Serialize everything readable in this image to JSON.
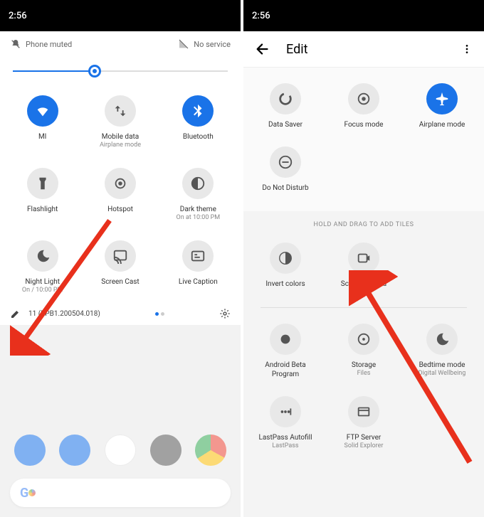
{
  "left": {
    "time": "2:56",
    "muted": "Phone muted",
    "service": "No service",
    "brightness_pct": 38,
    "tiles": [
      {
        "label": "MI",
        "sub": "",
        "on": true,
        "icon": "wifi"
      },
      {
        "label": "Mobile data",
        "sub": "Airplane mode",
        "on": false,
        "icon": "swap"
      },
      {
        "label": "Bluetooth",
        "sub": "",
        "on": true,
        "icon": "bluetooth"
      },
      {
        "label": "Flashlight",
        "sub": "",
        "on": false,
        "icon": "flashlight"
      },
      {
        "label": "Hotspot",
        "sub": "",
        "on": false,
        "icon": "hotspot"
      },
      {
        "label": "Dark theme",
        "sub": "On at 10:00 PM",
        "on": false,
        "icon": "dark"
      },
      {
        "label": "Night Light",
        "sub": "On / 10:00 PM",
        "on": false,
        "icon": "moon"
      },
      {
        "label": "Screen Cast",
        "sub": "",
        "on": false,
        "icon": "cast"
      },
      {
        "label": "Live Caption",
        "sub": "",
        "on": false,
        "icon": "caption"
      }
    ],
    "build": "11 (RPB1.200504.018)"
  },
  "right": {
    "time": "2:56",
    "title": "Edit",
    "active_tiles": [
      {
        "label": "Data Saver",
        "sub": "",
        "on": false,
        "icon": "datasaver"
      },
      {
        "label": "Focus mode",
        "sub": "",
        "on": false,
        "icon": "focus"
      },
      {
        "label": "Airplane mode",
        "sub": "",
        "on": true,
        "icon": "airplane"
      },
      {
        "label": "Do Not Disturb",
        "sub": "",
        "on": false,
        "icon": "dnd"
      }
    ],
    "drag_label": "HOLD AND DRAG TO ADD TILES",
    "inactive_tiles": [
      {
        "label": "Invert colors",
        "sub": "",
        "icon": "invert"
      },
      {
        "label": "Screen Record",
        "sub": "",
        "icon": "record"
      },
      {
        "label": "",
        "sub": "",
        "icon": ""
      },
      {
        "label": "Android Beta Program",
        "sub": "",
        "icon": "beta"
      },
      {
        "label": "Storage",
        "sub": "Files",
        "icon": "storage"
      },
      {
        "label": "Bedtime mode",
        "sub": "Digital Wellbeing",
        "icon": "bedtime"
      },
      {
        "label": "LastPass Autofill",
        "sub": "LastPass",
        "icon": "lastpass"
      },
      {
        "label": "FTP Server",
        "sub": "Solid Explorer",
        "icon": "ftp"
      }
    ]
  }
}
